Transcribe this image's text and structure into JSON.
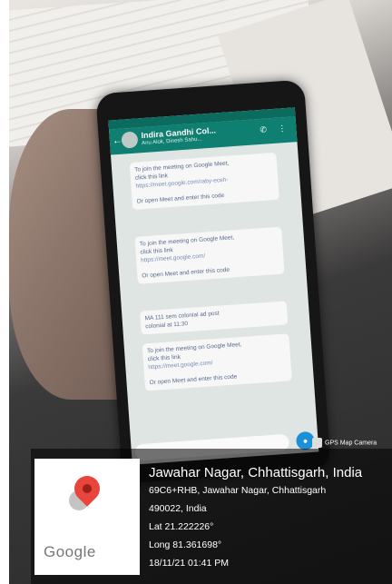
{
  "chat": {
    "title": "Indira Gandhi Col...",
    "subtitle": "Anu Alok, Dinesh Sahu...",
    "messages": [
      {
        "line1": "To join the meeting on Google Meet,",
        "line2": "click this link",
        "link": "https://meet.google.com/raby-eceh-",
        "extra": "Or open Meet and enter this code"
      },
      {
        "line1": "To join the meeting on Google Meet,",
        "line2": "click this link",
        "link": "https://meet.google.com/",
        "extra": "Or open Meet and enter this code"
      },
      {
        "line1": "MA 111 sem colonial ad post",
        "line2": "colonial at 11:30"
      },
      {
        "line1": "To join the meeting on Google Meet,",
        "line2": "click this link",
        "link": "https://meet.google.com/",
        "extra": "Or open Meet and enter this code"
      }
    ]
  },
  "gps_camera_label": "GPS Map Camera",
  "location": {
    "title": "Jawahar Nagar, Chhattisgarh, India",
    "address1": "69C6+RHB, Jawahar Nagar, Chhattisgarh",
    "address2": "490022, India",
    "lat": "Lat 21.222226°",
    "long": "Long 81.361698°",
    "datetime": "18/11/21 01:41 PM",
    "map_brand": "Google"
  },
  "colors": {
    "whatsapp_header": "#0e7f70",
    "pin_red": "#e8453c",
    "overlay_text": "#ffffff"
  }
}
